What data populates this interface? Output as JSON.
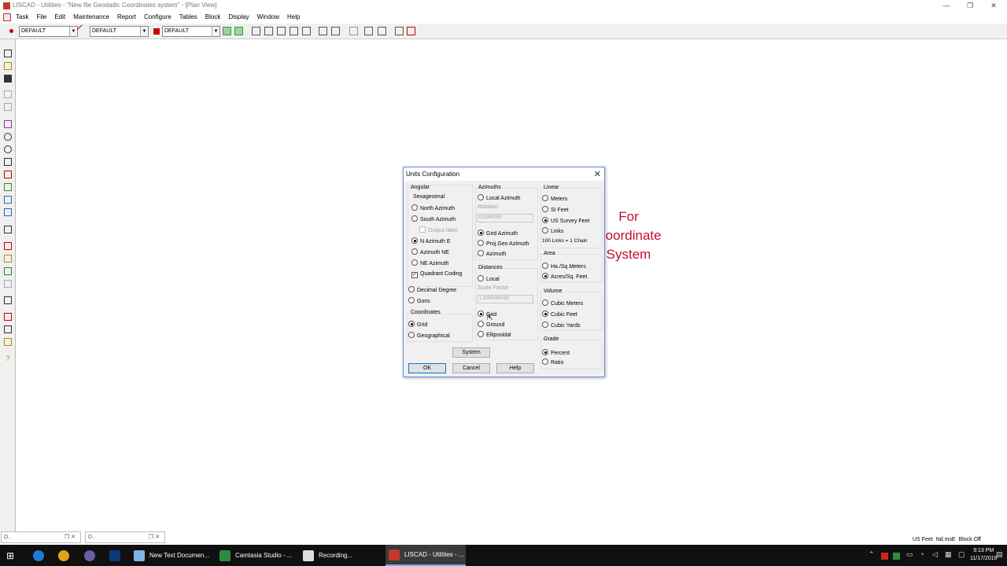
{
  "window": {
    "title": "LISCAD - Utilities - \"New file Geodadic Coordinates system\" - [Plan View]",
    "controls": [
      "—",
      "❐",
      "✕"
    ]
  },
  "menu": [
    "Task",
    "File",
    "Edit",
    "Maintenance",
    "Report",
    "Configure",
    "Tables",
    "Block",
    "Display",
    "Window",
    "Help"
  ],
  "toolbar": {
    "combo1": "DEFAULT",
    "combo2": "DEFAULT",
    "combo3": "DEFAULT",
    "accent": "#cc0000"
  },
  "dialog": {
    "title": "Units Configuration",
    "close": "✕",
    "angular": {
      "label": "Angular",
      "sexagesimal_label": "Sexagesimal",
      "north_azimuth": "North Azimuth",
      "south_azimuth": "South Azimuth",
      "output_label": "Output label",
      "n_azimuth_e": "N Azimuth E",
      "azimuth_ne": "Azimuth NE",
      "ne_azimuth": "NE Azimuth",
      "quadrant_coding": "Quadrant Coding",
      "decimal_degree": "Decimal Degree",
      "gons": "Gons",
      "selected": "N Azimuth E"
    },
    "coordinates": {
      "label": "Coordinates",
      "grid": "Grid",
      "geographical": "Geographical",
      "selected": "Grid"
    },
    "azimuths": {
      "label": "Azimuths",
      "local_azimuth": "Local Azimuth",
      "rotation_label": "Rotation",
      "rotation_value": "0.0000000",
      "grid_azimuth": "Grid Azimuth",
      "proj_geo_azimuth": "Proj.Geo Azimuth",
      "azimuth": "Azimuth",
      "selected": "Grid Azimuth"
    },
    "distances": {
      "label": "Distances",
      "local": "Local",
      "scale_factor_label": "Scale Factor",
      "scale_factor_value": "1.0000000000",
      "grid": "Grid",
      "ground": "Ground",
      "ellipsoidal": "Ellipsoidal",
      "selected": "Grid"
    },
    "linear": {
      "label": "Linear",
      "meters": "Meters",
      "si_feet": "SI Feet",
      "us_survey_feet": "US Survey Feet",
      "links": "Links",
      "links_note": "100 Links = 1 Chain",
      "selected": "US Survey Feet"
    },
    "area": {
      "label": "Area",
      "ha_sq_meters": "Ha./Sq.Meters",
      "acres_sq_feet": "Acres/Sq. Feet",
      "selected": "Acres/Sq. Feet"
    },
    "volume": {
      "label": "Volume",
      "cubic_meters": "Cubic Meters",
      "cubic_feet": "Cubic Feet",
      "cubic_yards": "Cubic Yards",
      "selected": "Cubic Feet"
    },
    "grade": {
      "label": "Grade",
      "percent": "Percent",
      "ratio": "Ratio",
      "selected": "Percent"
    },
    "buttons": {
      "system": "System",
      "ok": "OK",
      "cancel": "Cancel",
      "help": "Help"
    }
  },
  "annotation": {
    "line1": "For",
    "line2": "Coordinate",
    "line3": "System",
    "color": "#c0102c"
  },
  "minimized": [
    {
      "label": "D.."
    },
    {
      "label": "D.."
    }
  ],
  "status": [
    "US Feet",
    "Nd.msE",
    "Block Off"
  ],
  "taskbar": {
    "items": [
      {
        "label": "New Text Documen...",
        "icon": "notepad-icon"
      },
      {
        "label": "Camtasia Studio - ...",
        "icon": "camtasia-icon"
      },
      {
        "label": "Recording...",
        "icon": "recording-icon"
      },
      {
        "label": "LISCAD - Utilities - ...",
        "icon": "liscad-icon"
      }
    ],
    "time": "9:13 PM",
    "date": "11/17/2016"
  }
}
